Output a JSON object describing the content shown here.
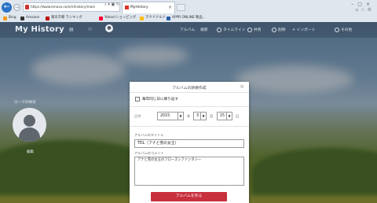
{
  "browser": {
    "address": "https://www.lenovo.com/mhistory/main",
    "tab_title": "MyHistory",
    "favorites": [
      "Bing",
      "Amazon",
      "楽天市場 ランキング",
      "Yahoo!ショッピング",
      "マクドナルド",
      "APPR ONLINE 製品..."
    ]
  },
  "app": {
    "title": "My History",
    "menu": {
      "albums": "アルバム",
      "search": "検索",
      "timeline": "タイムライン",
      "share": "共有",
      "delete": "削除",
      "import": "インポート",
      "other": "その他"
    },
    "profile_name": "ローマの休日",
    "avatar_label": "編集"
  },
  "dialog": {
    "title": "アルバムの新規作成",
    "checkbox_label": "毎年同じ日に繰り返す",
    "date_label": "日付",
    "year": "2015",
    "year_unit": "年",
    "month": "3",
    "month_unit": "月",
    "day": "15",
    "day_unit": "日",
    "album_title_label": "アルバムのタイトル",
    "album_title_value": "TDL（アナと雪の女王）",
    "comment_label": "アルバムのコメント",
    "comment_value": "アナと雪の女王のフローズンファンタジー",
    "create_button": "アルバムを作る"
  }
}
